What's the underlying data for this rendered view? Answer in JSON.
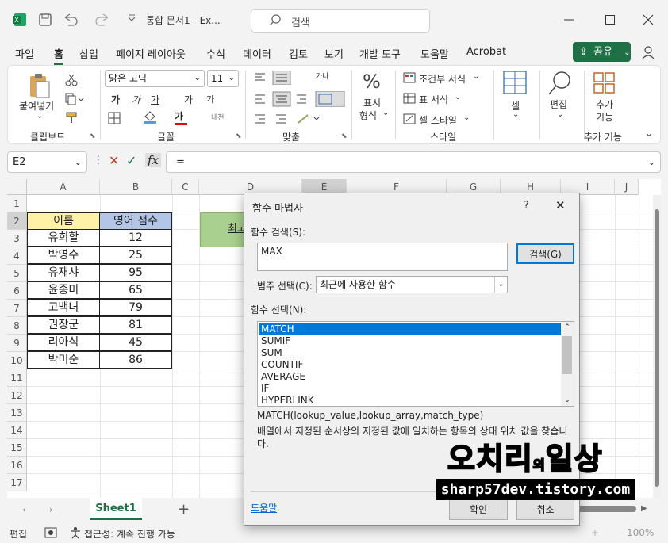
{
  "titlebar": {
    "doc_title": "통합 문서1 - Ex...",
    "search_placeholder": "검색"
  },
  "menu": [
    "파일",
    "홈",
    "삽입",
    "페이지 레이아웃",
    "수식",
    "데이터",
    "검토",
    "보기",
    "개발 도구",
    "도움말",
    "Acrobat"
  ],
  "share_label": "공유",
  "ribbon": {
    "paste_label": "붙여넣기",
    "clipboard_label": "클립보드",
    "font_name": "맑은 고딕",
    "font_size": "11",
    "font_label": "글꼴",
    "align_label": "맞춤",
    "number_label_1": "표시",
    "number_label_2": "형식",
    "cond_format": "조건부 서식",
    "table_format": "표 서식",
    "cell_style": "셀 스타일",
    "style_label": "스타일",
    "cell_label": "셀",
    "edit_label": "편집",
    "addin_label_1": "추가",
    "addin_label_2": "기능",
    "addin_group_label": "추가 기능",
    "btn_bold": "가",
    "btn_italic": "가",
    "btn_underline": "가",
    "btn_grow": "가",
    "btn_shrink": "가",
    "btn_fontcolor": "가",
    "btn_phonetic": "내천",
    "btn_wrap": "가나"
  },
  "formula_bar": {
    "name_box": "E2",
    "fx": "fx",
    "formula": "="
  },
  "sheet": {
    "columns": [
      "A",
      "B",
      "C",
      "D",
      "E",
      "F",
      "G",
      "H",
      "I",
      "J"
    ],
    "rows": [
      "1",
      "2",
      "3",
      "4",
      "5",
      "6",
      "7",
      "8",
      "9",
      "10",
      "11",
      "12",
      "13",
      "14",
      "15",
      "16",
      "17"
    ],
    "header": [
      "이름",
      "영어 점수"
    ],
    "data": [
      [
        "유희할",
        "12"
      ],
      [
        "박영수",
        "25"
      ],
      [
        "유재샤",
        "95"
      ],
      [
        "윤종미",
        "65"
      ],
      [
        "고백녀",
        "79"
      ],
      [
        "권장군",
        "81"
      ],
      [
        "리아식",
        "45"
      ],
      [
        "박미순",
        "86"
      ]
    ],
    "d2_partial": "최고",
    "header_color_a": "#fff2a8",
    "header_color_b": "#b4c6e7",
    "d2_color": "#a9d08e"
  },
  "sheet_tab": "Sheet1",
  "status": {
    "mode": "편집",
    "accessibility": "접근성: 계속 진행 가능",
    "zoom": "100%"
  },
  "dialog": {
    "title": "함수 마법사",
    "help_q": "?",
    "search_label": "함수 검색(S):",
    "search_value": "MAX",
    "search_btn": "검색(G)",
    "category_label": "범주 선택(C):",
    "category_value": "최근에 사용한 함수",
    "select_label": "함수 선택(N):",
    "functions": [
      "MATCH",
      "SUMIF",
      "SUM",
      "COUNTIF",
      "AVERAGE",
      "IF",
      "HYPERLINK"
    ],
    "selected_index": 0,
    "syntax": "MATCH(lookup_value,lookup_array,match_type)",
    "description": "배열에서 지정된 순서상의 지정된 값에 일치하는 항목의 상대 위치 값을 찾습니다.",
    "help_link": "도움말",
    "ok": "확인",
    "cancel": "취소"
  },
  "watermark": {
    "line1": "오치리",
    "line1_small": "의",
    "line1_end": "일상",
    "line2": "sharp57dev.tistory.com"
  },
  "accent_color": "#1e7145"
}
